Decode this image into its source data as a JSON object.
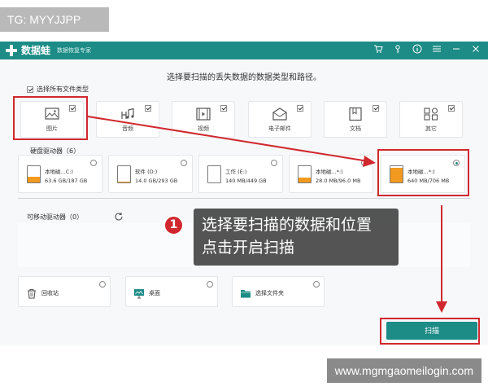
{
  "watermark_top": "TG: MYYJJPP",
  "watermark_bottom": "www.mgmgaomeilogin.com",
  "app": {
    "name": "数据蛙",
    "subtitle": "数据恢复专家",
    "titlebar_icons": [
      "cart-icon",
      "key-icon",
      "info-icon",
      "menu-icon",
      "minimize-icon",
      "close-icon"
    ]
  },
  "heading": "选择要扫描的丢失数据的数据类型和路径。",
  "select_all_label": "选择所有文件类型",
  "file_types": [
    {
      "label": "图片",
      "icon": "image-icon",
      "checked": true
    },
    {
      "label": "音频",
      "icon": "music-icon",
      "checked": true
    },
    {
      "label": "视频",
      "icon": "video-icon",
      "checked": true
    },
    {
      "label": "电子邮件",
      "icon": "mail-icon",
      "checked": true
    },
    {
      "label": "文档",
      "icon": "document-icon",
      "checked": true
    },
    {
      "label": "其它",
      "icon": "other-icon",
      "checked": true
    }
  ],
  "hard_drives_label": "硬盘驱动器（6）",
  "drives": [
    {
      "name": "本地磁...C:)",
      "size": "63.6 GB/187 GB",
      "fill_pct": 34,
      "selected": false
    },
    {
      "name": "软件 (D:)",
      "size": "14.0 GB/293 GB",
      "fill_pct": 5,
      "selected": false
    },
    {
      "name": "工作 (E:)",
      "size": "140 MB/449 GB",
      "fill_pct": 1,
      "selected": false
    },
    {
      "name": "本地磁...*:)",
      "size": "28.0 MB/96.0 MB",
      "fill_pct": 29,
      "selected": false
    },
    {
      "name": "本地磁...*:)",
      "size": "640 MB/706 MB",
      "fill_pct": 90,
      "selected": true
    }
  ],
  "removable_label": "可移动驱动器（0）",
  "locations": [
    {
      "label": "回收站",
      "icon": "recycle-bin-icon"
    },
    {
      "label": "桌面",
      "icon": "desktop-icon"
    },
    {
      "label": "选择文件夹",
      "icon": "folder-icon"
    }
  ],
  "callout": {
    "step": "1",
    "line1": "选择要扫描的数据和位置",
    "line2": "点击开启扫描"
  },
  "scan_button": "扫描",
  "colors": {
    "accent": "#1d8b86",
    "highlight": "#d0282e",
    "drive_fill": "#f29a1f"
  }
}
